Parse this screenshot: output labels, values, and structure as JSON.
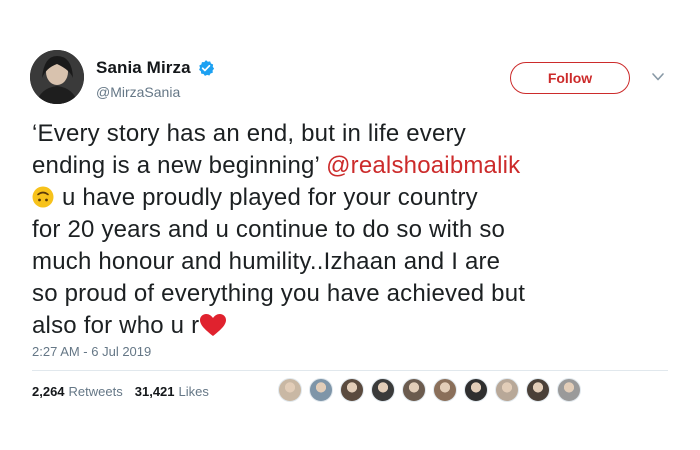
{
  "author": {
    "display_name": "Sania Mirza",
    "handle": "@MirzaSania",
    "verified": true,
    "avatar_icon": "profile-photo-avatar"
  },
  "follow_button": {
    "label": "Follow"
  },
  "menu": {
    "icon": "chevron-down-icon"
  },
  "tweet": {
    "lines": [
      "‘Every story has an end, but in life every",
      "ending is a new beginning’ ",
      "u have proudly played for your country",
      "for 20 years and u continue to do so with so",
      "much honour and humility..Izhaan and I are",
      "so proud of everything you have achieved but",
      "also for who u r"
    ],
    "mention": "@realshoaibmalik",
    "emojis": [
      "upside-down-face-emoji",
      "red-heart-emoji"
    ]
  },
  "timestamp": "2:27 AM - 6 Jul 2019",
  "stats": {
    "retweets_count": "2,264",
    "retweets_label": "Retweets",
    "likes_count": "31,421",
    "likes_label": "Likes"
  },
  "likers": [
    {
      "icon": "liker-avatar-1",
      "color": "#c9b8a4"
    },
    {
      "icon": "liker-avatar-2",
      "color": "#7e95a8"
    },
    {
      "icon": "liker-avatar-3",
      "color": "#5a4a3e"
    },
    {
      "icon": "liker-avatar-4",
      "color": "#3a3a3a"
    },
    {
      "icon": "liker-avatar-5",
      "color": "#6b5b4e"
    },
    {
      "icon": "liker-avatar-6",
      "color": "#8a6f5a"
    },
    {
      "icon": "liker-avatar-7",
      "color": "#2f2f2f"
    },
    {
      "icon": "liker-avatar-8",
      "color": "#b8a898"
    },
    {
      "icon": "liker-avatar-9",
      "color": "#4a4038"
    },
    {
      "icon": "liker-avatar-10",
      "color": "#9a9a9a"
    }
  ],
  "colors": {
    "accent": "#cc2b2b",
    "verified_blue": "#1da1f2",
    "secondary_text": "#657786",
    "divider": "#e1e8ed"
  }
}
